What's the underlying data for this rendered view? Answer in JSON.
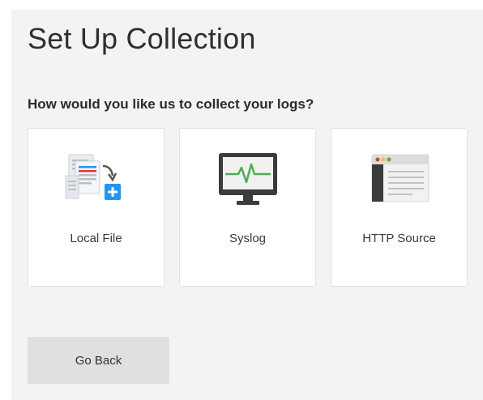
{
  "page": {
    "title": "Set Up Collection",
    "question": "How would you like us to collect your logs?"
  },
  "options": [
    {
      "label": "Local File",
      "icon": "local-file-icon"
    },
    {
      "label": "Syslog",
      "icon": "syslog-monitor-icon"
    },
    {
      "label": "HTTP Source",
      "icon": "http-browser-icon"
    }
  ],
  "actions": {
    "back_label": "Go Back"
  },
  "colors": {
    "panel_background": "#f3f3f3",
    "card_background": "#ffffff",
    "card_border": "#e2e2e2",
    "button_background": "#e0e0e0",
    "accent_blue": "#2196f3",
    "accent_green": "#4caf50",
    "accent_red": "#e53935",
    "icon_dark": "#3b3b3b"
  }
}
